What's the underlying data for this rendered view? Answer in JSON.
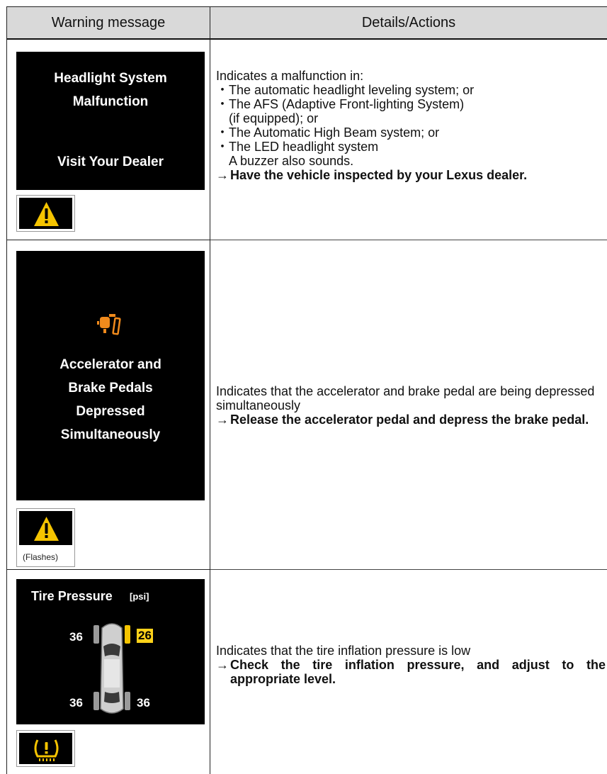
{
  "header": {
    "col_warning": "Warning message",
    "col_details": "Details/Actions"
  },
  "rows": [
    {
      "screen_lines": [
        "Headlight System",
        "Malfunction",
        "Visit Your Dealer"
      ],
      "icon": "warning-triangle-icon",
      "detail_intro": "Indicates a malfunction in:",
      "bullets": [
        "The automatic headlight leveling system; or",
        "The AFS (Adaptive Front-lighting System)",
        "The Automatic High Beam system; or",
        "The LED headlight system"
      ],
      "bullet_continuations": [
        "(if equipped); or",
        "A buzzer also sounds."
      ],
      "arrow": "→",
      "action": "Have the vehicle inspected by your Lexus dealer."
    },
    {
      "screen_lines": [
        "Accelerator and",
        "Brake Pedals",
        "Depressed",
        "Simultaneously"
      ],
      "icon": "pedal-icon",
      "warn_icon": "warning-triangle-icon",
      "warn_caption": "(Flashes)",
      "detail_intro": "Indicates that the accelerator and brake pedal are being depressed simultaneously",
      "arrow": "→",
      "action": "Release the accelerator pedal and depress the brake pedal."
    },
    {
      "screen_title": "Tire Pressure",
      "screen_unit": "[psi]",
      "pressures": {
        "front_left": "36",
        "front_right": "26",
        "rear_left": "36",
        "rear_right": "36"
      },
      "icon": "tire-pressure-warning-icon",
      "detail_intro": "Indicates that the tire inflation pressure is low",
      "arrow": "→",
      "action": "Check the tire inflation pressure, and adjust to the appropriate level."
    }
  ],
  "colors": {
    "header_bg": "#d9d9d9",
    "warning_yellow": "#f5c400",
    "pedal_orange": "#f08a1c",
    "low_pressure": "#ffd21a"
  }
}
